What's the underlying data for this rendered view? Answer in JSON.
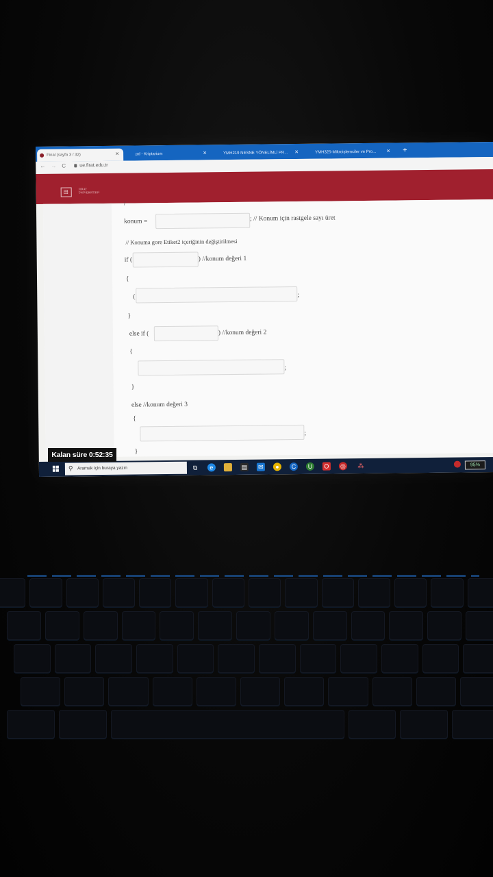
{
  "browser": {
    "tabs": [
      {
        "title": "Final (sayfa 3 / 32)",
        "active": true
      },
      {
        "title": "pd - Kriptarium",
        "active": false
      },
      {
        "title": "YMH219 NESNE YÖNELİMLİ PR...",
        "active": false
      },
      {
        "title": "YMH325-Mikroişlemciler ve Pro...",
        "active": false
      }
    ],
    "url": "ue.firat.edu.tr",
    "new_tab": "+"
  },
  "site": {
    "logo_line1": "FIRAT",
    "logo_line2": "ÜNİVERSİTESİ",
    "logo_mark": "田"
  },
  "code": {
    "top_fragment": "/",
    "line_konum_prefix": "konum =",
    "line_konum_suffix": "; // Konum için rastgele sayı üret",
    "comment_change": "// Konuma gore Etiket2 içeriğinin değiştirilmesi",
    "if_prefix": "if (",
    "if_suffix": ") //konum değeri 1",
    "open_brace_1": "{",
    "paren_1": "(",
    "semi_1": ";",
    "close_brace_1": "}",
    "elseif_prefix": "else if (",
    "elseif_suffix": ") //konum değeri 2",
    "open_brace_2": "{",
    "semi_2": ";",
    "close_brace_2": "}",
    "else_label": "else  //konum değeri 3",
    "open_brace_3": "{",
    "semi_3": ";",
    "close_brace_3": "}"
  },
  "timer": {
    "label": "Kalan süre",
    "value": "0:52:35"
  },
  "taskbar": {
    "search_placeholder": "Aramak için buraya yazın",
    "battery": "95%"
  }
}
